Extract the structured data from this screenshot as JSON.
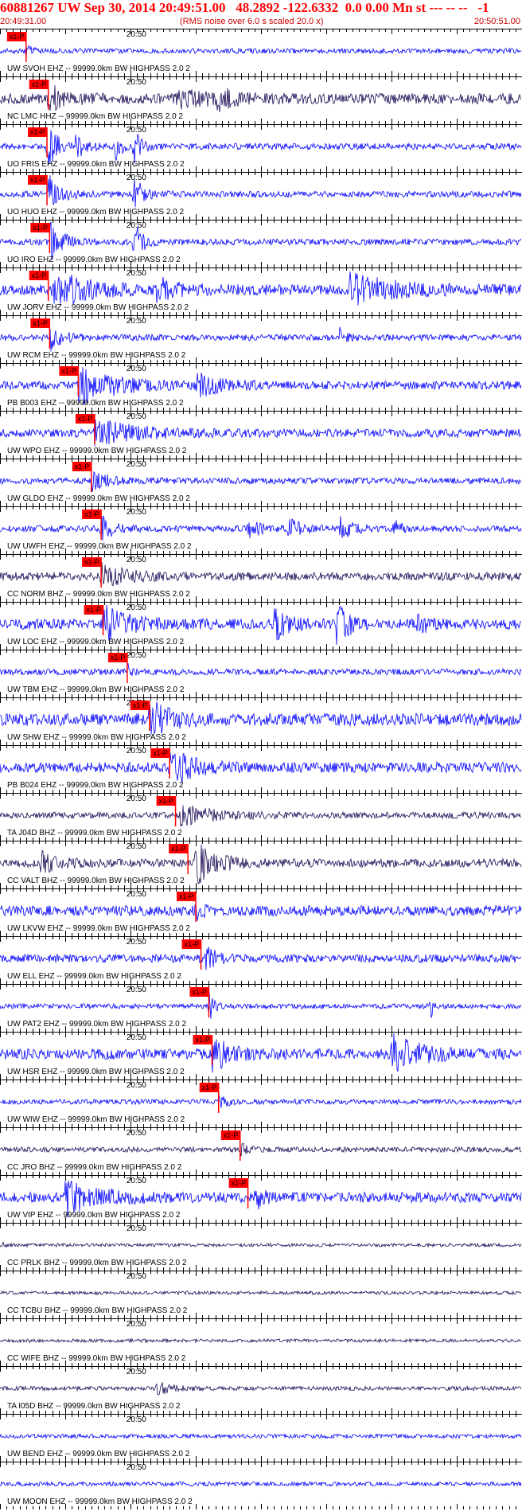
{
  "header": {
    "title": "60881267 UW Sep 30, 2014 20:49:51.00   48.2892 -122.6332  0.0 0.00 Mn st --- -- --   -1",
    "start_time": "20:49:31.00",
    "rms_note": "(RMS noise over 6.0 s scaled 20.0 x)",
    "end_time": "20:50:51.00"
  },
  "colors": {
    "blue_trace": "#0000ff",
    "dark_trace": "#1c0a55",
    "pick": "#ff0000",
    "text": "#000000"
  },
  "chart_data": {
    "type": "line",
    "x_axis": {
      "start": "20:49:31.00",
      "end": "20:50:51.00",
      "mid_tick_label": "20:50",
      "minor_tick_s": 1,
      "major_tick_s": 10
    },
    "pick_label": "x1-P",
    "traces": [
      {
        "label": "UW SVOH EHZ -- 99999.0km BW  HIGHPASS  2.0  2",
        "color": "blue",
        "pick_time_s": 4.0,
        "noise": 0.12,
        "events": [
          [
            4.0,
            0.5,
            1.0
          ]
        ]
      },
      {
        "label": "NC LMC HHZ -- 99999.0km BW  HIGHPASS  2.0  2",
        "color": "dark",
        "pick_time_s": 7.4,
        "noise": 0.25,
        "events": [
          [
            7.4,
            0.6,
            4.0
          ],
          [
            27.0,
            0.35,
            8.0
          ],
          [
            33.0,
            0.6,
            3.0
          ]
        ]
      },
      {
        "label": "UO FRIS EHZ -- 99999.0km BW  HIGHPASS  2.0  2",
        "color": "blue",
        "pick_time_s": 7.2,
        "noise": 0.15,
        "events": [
          [
            7.2,
            1.0,
            3.0
          ],
          [
            11.5,
            0.6,
            2.0
          ],
          [
            17.5,
            0.8,
            1.5
          ],
          [
            20.5,
            1.0,
            1.5
          ]
        ]
      },
      {
        "label": "UO HUO EHZ -- 99999.0km BW  HIGHPASS  2.0  2",
        "color": "blue",
        "pick_time_s": 7.2,
        "noise": 0.15,
        "events": [
          [
            7.2,
            1.0,
            3.0
          ],
          [
            20.5,
            1.0,
            2.0
          ]
        ]
      },
      {
        "label": "UO IRO EHZ -- 99999.0km BW  HIGHPASS  2.0  2",
        "color": "blue",
        "pick_time_s": 7.6,
        "noise": 0.15,
        "events": [
          [
            7.6,
            1.0,
            3.0
          ],
          [
            20.5,
            1.0,
            2.0
          ]
        ]
      },
      {
        "label": "UW JORV EHZ -- 99999.0km BW  HIGHPASS  2.0  2",
        "color": "blue",
        "pick_time_s": 7.4,
        "noise": 0.25,
        "events": [
          [
            8.0,
            1.0,
            8.0
          ],
          [
            24.0,
            0.5,
            6.0
          ],
          [
            53.0,
            0.8,
            10.0
          ]
        ]
      },
      {
        "label": "UW RCM EHZ -- 99999.0km BW  HIGHPASS  2.0  2",
        "color": "blue",
        "pick_time_s": 7.6,
        "noise": 0.15,
        "events": [
          [
            7.6,
            0.6,
            3.0
          ],
          [
            52.0,
            0.4,
            1.5
          ]
        ]
      },
      {
        "label": "PB B003 EHZ -- 99999.0km BW  HIGHPASS  2.0  2",
        "color": "blue",
        "pick_time_s": 12.0,
        "noise": 0.2,
        "events": [
          [
            12.0,
            1.0,
            8.0
          ],
          [
            30.0,
            0.5,
            6.0
          ]
        ]
      },
      {
        "label": "UW WPO EHZ -- 99999.0km BW  HIGHPASS  2.0  2",
        "color": "blue",
        "pick_time_s": 14.5,
        "noise": 0.2,
        "events": [
          [
            14.5,
            0.6,
            10.0
          ]
        ]
      },
      {
        "label": "UW GLDO EHZ -- 99999.0km BW  HIGHPASS  2.0  2",
        "color": "blue",
        "pick_time_s": 14.0,
        "noise": 0.15,
        "events": [
          [
            14.0,
            0.45,
            4.0
          ]
        ]
      },
      {
        "label": "UW UWFH EHZ -- 99999.0km BW  HIGHPASS  2.0  2",
        "color": "blue",
        "pick_time_s": 15.5,
        "noise": 0.15,
        "events": [
          [
            15.5,
            0.6,
            3.0
          ],
          [
            38.0,
            0.4,
            3.0
          ],
          [
            44.0,
            0.5,
            3.0
          ],
          [
            52.0,
            0.6,
            3.0
          ],
          [
            60.0,
            0.5,
            2.0
          ]
        ]
      },
      {
        "label": "CC NORM BHZ -- 99999.0km BW  HIGHPASS  2.0  2",
        "color": "dark",
        "pick_time_s": 15.5,
        "noise": 0.2,
        "events": [
          [
            15.5,
            0.5,
            6.0
          ]
        ]
      },
      {
        "label": "UW LOC EHZ -- 99999.0km BW  HIGHPASS  2.0  2",
        "color": "blue",
        "pick_time_s": 15.8,
        "noise": 0.25,
        "events": [
          [
            15.8,
            0.8,
            6.0
          ],
          [
            42.0,
            0.8,
            3.0
          ],
          [
            51.5,
            1.0,
            3.0
          ],
          [
            64.0,
            0.5,
            2.0
          ]
        ]
      },
      {
        "label": "UW TBM EHZ -- 99999.0km BW  HIGHPASS  2.0  2",
        "color": "blue",
        "pick_time_s": 19.5,
        "noise": 0.15,
        "events": [
          [
            19.5,
            0.4,
            1.0
          ]
        ]
      },
      {
        "label": "UW SHW EHZ -- 99999.0km BW  HIGHPASS  2.0  2",
        "color": "blue",
        "pick_time_s": 22.9,
        "noise": 0.3,
        "events": [
          [
            22.9,
            1.0,
            4.0
          ]
        ]
      },
      {
        "label": "PB B024 EHZ -- 99999.0km BW  HIGHPASS  2.0  2",
        "color": "blue",
        "pick_time_s": 26.0,
        "noise": 0.25,
        "events": [
          [
            26.0,
            1.0,
            5.0
          ]
        ]
      },
      {
        "label": "TA J04D BHZ -- 99999.0km BW  HIGHPASS  2.0  2",
        "color": "dark",
        "pick_time_s": 26.9,
        "noise": 0.15,
        "events": [
          [
            27.5,
            0.5,
            8.0
          ]
        ]
      },
      {
        "label": "CC VALT BHZ -- 99999.0km BW  HIGHPASS  2.0  2",
        "color": "dark",
        "pick_time_s": 28.8,
        "noise": 0.2,
        "events": [
          [
            6.0,
            0.5,
            4.0
          ],
          [
            30.0,
            1.0,
            5.0
          ]
        ]
      },
      {
        "label": "UW LKVW EHZ -- 99999.0km BW  HIGHPASS  2.0  2",
        "color": "blue",
        "pick_time_s": 30.0,
        "noise": 0.25,
        "events": [
          [
            30.0,
            0.4,
            2.0
          ]
        ]
      },
      {
        "label": "UW ELL EHZ -- 99999.0km BW  HIGHPASS  2.0  2",
        "color": "blue",
        "pick_time_s": 30.8,
        "noise": 0.2,
        "events": [
          [
            31.5,
            0.5,
            3.0
          ]
        ]
      },
      {
        "label": "UW PAT2 EHZ -- 99999.0km BW  HIGHPASS  2.0  2",
        "color": "blue",
        "pick_time_s": 32.0,
        "noise": 0.12,
        "events": [
          [
            32.0,
            1.0,
            1.0
          ],
          [
            66.0,
            0.7,
            0.5
          ]
        ]
      },
      {
        "label": "UW HSR EHZ -- 99999.0km BW  HIGHPASS  2.0  2",
        "color": "blue",
        "pick_time_s": 32.5,
        "noise": 0.25,
        "events": [
          [
            32.5,
            0.8,
            4.0
          ],
          [
            60.0,
            1.0,
            6.0
          ]
        ]
      },
      {
        "label": "UW WIW EHZ -- 99999.0km BW  HIGHPASS  2.0  2",
        "color": "blue",
        "pick_time_s": 33.5,
        "noise": 0.12,
        "events": [
          [
            33.5,
            0.3,
            2.0
          ]
        ]
      },
      {
        "label": "CC JRO BHZ -- 99999.0km BW  HIGHPASS  2.0  2",
        "color": "dark",
        "pick_time_s": 36.8,
        "noise": 0.12,
        "events": [
          [
            36.8,
            0.3,
            2.0
          ]
        ]
      },
      {
        "label": "UW VIP EHZ -- 99999.0km BW  HIGHPASS  2.0  2",
        "color": "blue",
        "pick_time_s": 38.0,
        "noise": 0.25,
        "events": [
          [
            10.0,
            0.8,
            8.0
          ],
          [
            39.0,
            0.8,
            2.0
          ]
        ]
      },
      {
        "label": "CC PRLK BHZ -- 99999.0km BW  HIGHPASS  2.0  2",
        "color": "dark",
        "pick_time_s": null,
        "noise": 0.08,
        "events": [
          [
            0.5,
            0.3,
            0.5
          ]
        ]
      },
      {
        "label": "CC TCBU BHZ -- 99999.0km BW  HIGHPASS  2.0  2",
        "color": "dark",
        "pick_time_s": null,
        "noise": 0.08,
        "events": []
      },
      {
        "label": "CC WIFE BHZ -- 99999.0km BW  HIGHPASS  2.0  2",
        "color": "dark",
        "pick_time_s": null,
        "noise": 0.08,
        "events": []
      },
      {
        "label": "TA I05D BHZ -- 99999.0km BW  HIGHPASS  2.0  2",
        "color": "dark",
        "pick_time_s": null,
        "noise": 0.1,
        "events": [
          [
            24.0,
            0.3,
            4.0
          ]
        ]
      },
      {
        "label": "UW BEND EHZ -- 99999.0km BW  HIGHPASS  2.0  2",
        "color": "blue",
        "pick_time_s": null,
        "noise": 0.1,
        "events": []
      },
      {
        "label": "UW MOON EHZ -- 99999.0km BW  HIGHPASS  2.0  2",
        "color": "blue",
        "pick_time_s": null,
        "noise": 0.1,
        "events": []
      }
    ]
  }
}
